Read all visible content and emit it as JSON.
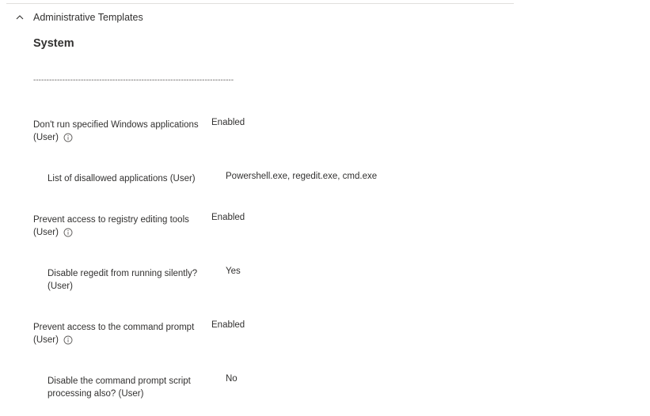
{
  "section": {
    "title": "Administrative Templates",
    "chevron_icon": "chevron-up-icon"
  },
  "category": {
    "title": "System",
    "separator": "----------------------------------------------------------------------------"
  },
  "settings": [
    {
      "label_line1": "Don't run specified Windows applications",
      "label_line2": "(User)",
      "value": "Enabled",
      "has_info": true
    },
    {
      "label_line1": "List of disallowed applications (User)",
      "label_line2": "",
      "value": "Powershell.exe, regedit.exe, cmd.exe",
      "has_info": false
    },
    {
      "label_line1": "Prevent access to registry editing tools",
      "label_line2": "(User)",
      "value": "Enabled",
      "has_info": true
    },
    {
      "label_line1": "Disable regedit from running silently?",
      "label_line2": "(User)",
      "value": "Yes",
      "has_info": false
    },
    {
      "label_line1": "Prevent access to the command prompt",
      "label_line2": "(User)",
      "value": "Enabled",
      "has_info": true
    },
    {
      "label_line1": "Disable the command prompt script",
      "label_line2": "processing also? (User)",
      "value": "No",
      "has_info": false
    }
  ]
}
